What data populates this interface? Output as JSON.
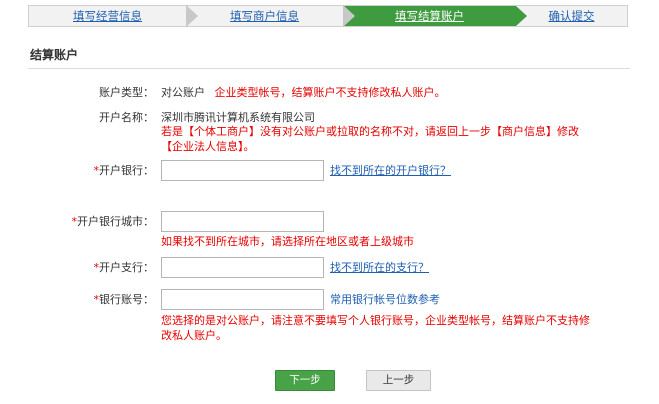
{
  "steps": [
    {
      "label": "填写经营信息",
      "state": "done"
    },
    {
      "label": "填写商户信息",
      "state": "done"
    },
    {
      "label": "填写结算账户",
      "state": "active"
    },
    {
      "label": "确认提交",
      "state": "todo"
    }
  ],
  "section": {
    "title": "结算账户"
  },
  "account_type": {
    "label": "账户类型：",
    "value": "对公账户",
    "note": "企业类型帐号，结算账户不支持修改私人账户。"
  },
  "account_name": {
    "label": "开户名称：",
    "value": "深圳市腾讯计算机系统有限公司",
    "warning_line1": "若是【个体工商户】没有对公账户或拉取的名称不对，请返回上一步【商户信息】修改",
    "warning_line2": "【企业法人信息】。"
  },
  "bank": {
    "required_mark": "*",
    "label": "开户银行：",
    "value": "",
    "link": "找不到所在的开户银行？"
  },
  "bank_city": {
    "required_mark": "*",
    "label": "开户银行城市：",
    "value": "",
    "hint": "如果找不到所在城市，请选择所在地区或者上级城市"
  },
  "branch": {
    "required_mark": "*",
    "label": "开户支行：",
    "value": "",
    "link": "找不到所在的支行？"
  },
  "account_number": {
    "required_mark": "*",
    "label": "银行账号：",
    "value": "",
    "hint": "常用银行帐号位数参考",
    "warning_line1": "您选择的是对公账户，请注意不要填写个人银行账号，企业类型帐号，结算账户不支持修",
    "warning_line2": "改私人账户。"
  },
  "buttons": {
    "next": "下一步",
    "prev": "上一步"
  },
  "colors": {
    "accent_green": "#3f9b3f",
    "link_blue": "#1f5fb0",
    "error_red": "#e60000"
  }
}
